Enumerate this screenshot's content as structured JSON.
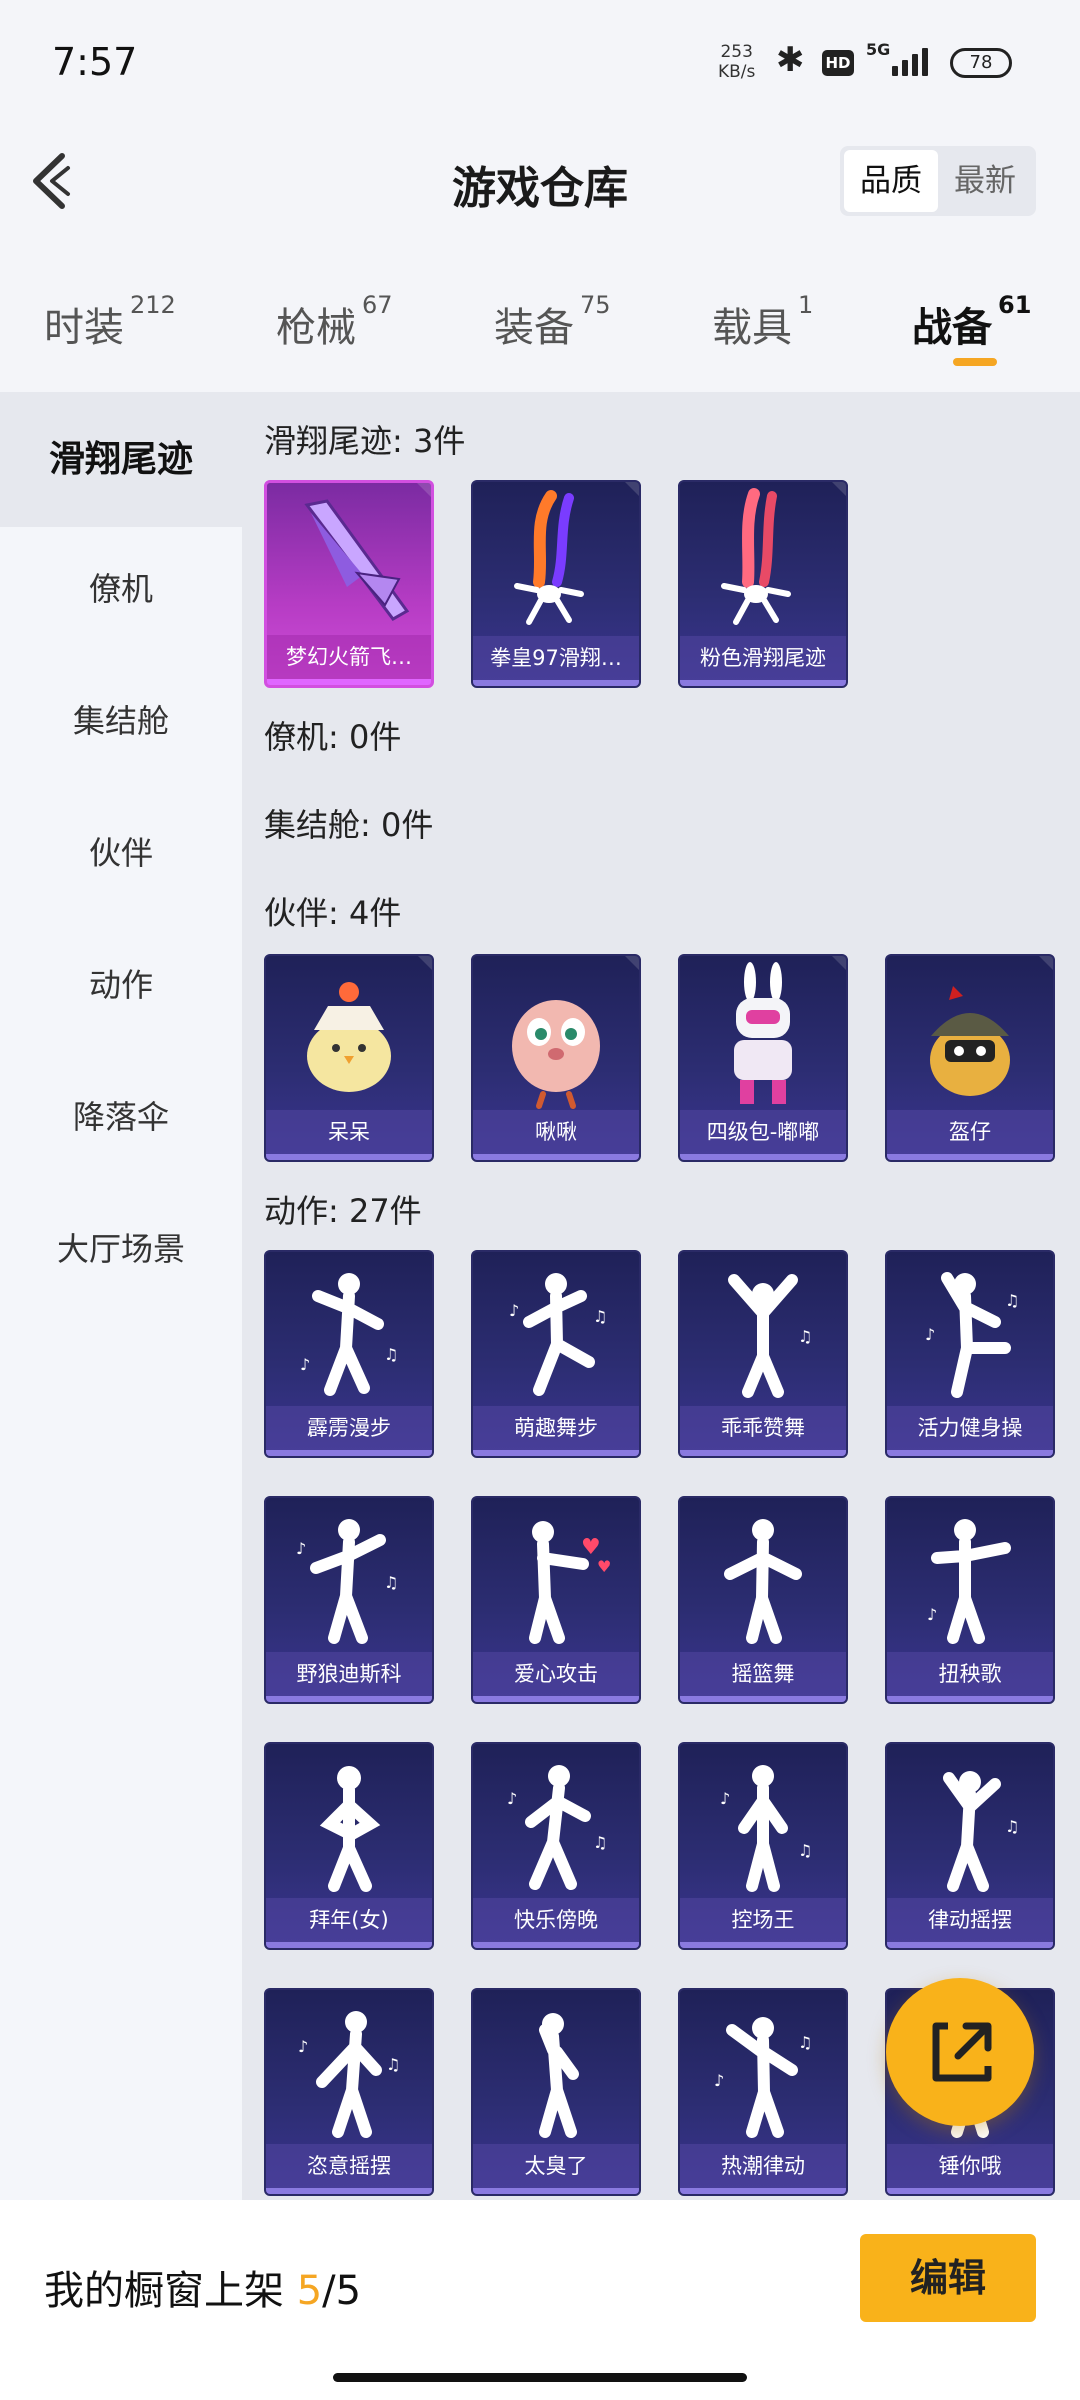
{
  "status_bar": {
    "time": "7:57",
    "net_speed_value": "253",
    "net_speed_unit": "KB/s",
    "hd": "HD",
    "network": "5G",
    "battery": "78"
  },
  "header": {
    "title": "游戏仓库",
    "sort_options": [
      "品质",
      "最新"
    ]
  },
  "tabs": [
    {
      "label": "时装",
      "count": "212"
    },
    {
      "label": "枪械",
      "count": "67"
    },
    {
      "label": "装备",
      "count": "75"
    },
    {
      "label": "载具",
      "count": "1"
    },
    {
      "label": "战备",
      "count": "61"
    }
  ],
  "sidebar": [
    "滑翔尾迹",
    "僚机",
    "集结舱",
    "伙伴",
    "动作",
    "降落伞",
    "大厅场景"
  ],
  "sections": {
    "glide": {
      "title": "滑翔尾迹: 3件",
      "items": [
        "梦幻火箭飞…",
        "拳皇97滑翔…",
        "粉色滑翔尾迹"
      ]
    },
    "wingman": {
      "title": "僚机: 0件"
    },
    "capsule": {
      "title": "集结舱: 0件"
    },
    "partner": {
      "title": "伙伴: 4件",
      "items": [
        "呆呆",
        "啾啾",
        "四级包-嘟嘟",
        "盔仔"
      ]
    },
    "emote": {
      "title": "动作: 27件",
      "items": [
        "霹雳漫步",
        "萌趣舞步",
        "乖乖赞舞",
        "活力健身操",
        "野狼迪斯科",
        "爱心攻击",
        "摇篮舞",
        "扭秧歌",
        "拜年(女)",
        "快乐傍晚",
        "控场王",
        "律动摇摆",
        "恣意摇摆",
        "太臭了",
        "热潮律动",
        "锤你哦"
      ]
    }
  },
  "bottom": {
    "shelf_label": "我的橱窗上架",
    "shelf_current": "5",
    "shelf_sep": "/",
    "shelf_total": "5",
    "edit_label": "编辑"
  },
  "colors": {
    "accent": "#f9b21a",
    "card_bg": "#2c2d72",
    "legend_card": "#b63cc4"
  },
  "icons": [
    "back-arrow-icon",
    "bluetooth-icon",
    "signal-icon",
    "battery-icon",
    "share-icon",
    "dancer-icon"
  ]
}
